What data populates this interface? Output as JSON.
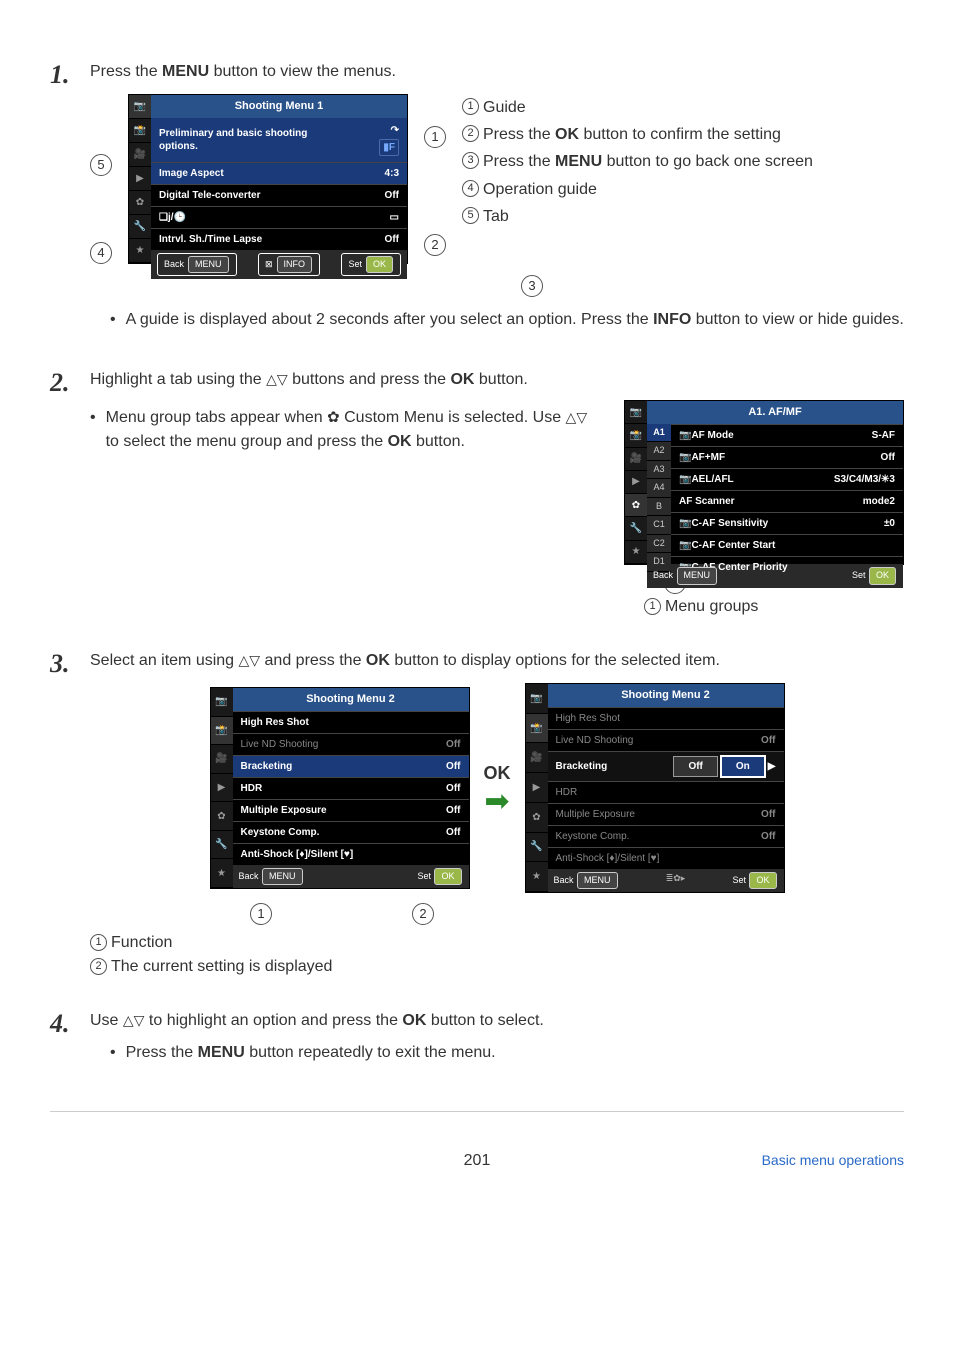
{
  "step1": {
    "intro_pre": "Press the ",
    "intro_bold": "MENU",
    "intro_post": " button to view the menus.",
    "menu": {
      "title": "Shooting Menu 1",
      "hint": "Preliminary and basic shooting options.",
      "rows": [
        {
          "label": "Image Aspect",
          "val": "4:3"
        },
        {
          "label": "Digital Tele-converter",
          "val": "Off"
        },
        {
          "label": "❑j/🕒",
          "val": "▭"
        },
        {
          "label": "Intrvl. Sh./Time Lapse",
          "val": "Off"
        }
      ],
      "back": "Back",
      "info_icon": "⊠",
      "set": "Set",
      "qual_icon": "▮F"
    },
    "legend": {
      "i1": "Guide",
      "i2_pre": "Press the ",
      "i2_bold": "OK",
      "i2_post": " button to confirm the setting",
      "i3_pre": "Press the ",
      "i3_bold": "MENU",
      "i3_post": " button to go back one screen",
      "i4": "Operation guide",
      "i5": "Tab"
    },
    "note_pre": "A guide is displayed about 2 seconds after you select an option. Press the ",
    "note_bold": "INFO",
    "note_post": " button to view or hide guides."
  },
  "step2": {
    "intro_pre": "Highlight a tab using the ",
    "intro_post": " buttons and press the ",
    "intro_bold": "OK",
    "intro_end": " button.",
    "bullet_pre": "Menu group tabs appear when ",
    "bullet_post": " Custom Menu is selected. Use ",
    "bullet_end_pre": " to select the menu group and press the ",
    "bullet_bold": "OK",
    "bullet_end": " button.",
    "menu": {
      "title": "A1. AF/MF",
      "subtabs": [
        "A1",
        "A2",
        "A3",
        "A4",
        "B",
        "C1",
        "C2",
        "D1"
      ],
      "rows": [
        {
          "label": "📷AF Mode",
          "val": "S-AF"
        },
        {
          "label": "📷AF+MF",
          "val": "Off"
        },
        {
          "label": "📷AEL/AFL",
          "val": "S3/C4/M3/✳3"
        },
        {
          "label": "AF Scanner",
          "val": "mode2"
        },
        {
          "label": "📷C-AF Sensitivity",
          "val": "±0"
        },
        {
          "label": "📷C-AF Center Start",
          "val": ""
        },
        {
          "label": "📷C-AF Center Priority",
          "val": ""
        }
      ],
      "back": "Back",
      "set": "Set"
    },
    "legend1": "Menu groups"
  },
  "step3": {
    "intro_pre": "Select an item using ",
    "intro_mid": " and press the ",
    "intro_bold": "OK",
    "intro_post": " button to display options for the selected item.",
    "left": {
      "title": "Shooting Menu 2",
      "rows": [
        {
          "label": "High Res Shot",
          "val": ""
        },
        {
          "label": "Live ND Shooting",
          "val": "Off",
          "dim": true
        },
        {
          "label": "Bracketing",
          "val": "Off",
          "hl": true
        },
        {
          "label": "HDR",
          "val": "Off"
        },
        {
          "label": "Multiple Exposure",
          "val": "Off"
        },
        {
          "label": "Keystone Comp.",
          "val": "Off"
        },
        {
          "label": "Anti-Shock [♦]/Silent [♥]",
          "val": ""
        }
      ],
      "back": "Back",
      "set": "Set"
    },
    "ok_label": "OK",
    "right": {
      "title": "Shooting Menu 2",
      "rows": [
        {
          "label": "High Res Shot",
          "val": "",
          "dim": true
        },
        {
          "label": "Live ND Shooting",
          "val": "Off",
          "dim": true
        },
        {
          "label": "Bracketing",
          "val": "",
          "off": "Off",
          "on": "On"
        },
        {
          "label": "HDR",
          "val": "",
          "dim": true
        },
        {
          "label": "Multiple Exposure",
          "val": "Off",
          "dim": true
        },
        {
          "label": "Keystone Comp.",
          "val": "Off",
          "dim": true
        },
        {
          "label": "Anti-Shock [♦]/Silent [♥]",
          "val": "",
          "dim": true
        }
      ],
      "back": "Back",
      "set": "Set",
      "mid_icon": "≣✿▸"
    },
    "legend1": "Function",
    "legend2": "The current setting is displayed"
  },
  "step4": {
    "intro_pre": "Use ",
    "intro_mid": " to highlight an option and press the ",
    "intro_bold": "OK",
    "intro_post": " button to select.",
    "bullet_pre": "Press the ",
    "bullet_bold": "MENU",
    "bullet_post": " button repeatedly to exit the menu."
  },
  "footer": {
    "page": "201",
    "link": "Basic menu operations"
  }
}
